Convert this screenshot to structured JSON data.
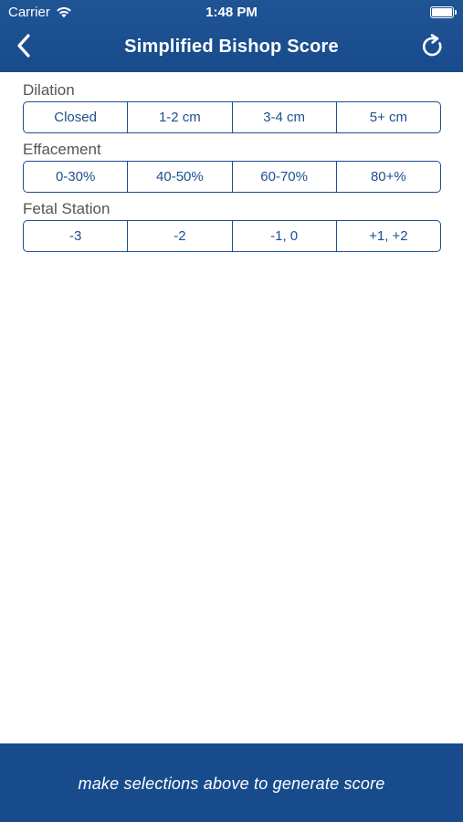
{
  "colors": {
    "brand": "#184b8c",
    "accent": "#1d4f8f",
    "label_text": "#555555",
    "background": "#ffffff"
  },
  "status_bar": {
    "carrier": "Carrier",
    "time": "1:48 PM",
    "icons": [
      "wifi-icon",
      "battery-icon"
    ]
  },
  "nav": {
    "title": "Simplified Bishop Score",
    "back_icon": "chevron-left-icon",
    "reset_icon": "refresh-icon"
  },
  "sections": [
    {
      "label": "Dilation",
      "options": [
        "Closed",
        "1-2 cm",
        "3-4 cm",
        "5+ cm"
      ]
    },
    {
      "label": "Effacement",
      "options": [
        "0-30%",
        "40-50%",
        "60-70%",
        "80+%"
      ]
    },
    {
      "label": "Fetal Station",
      "options": [
        "-3",
        "-2",
        "-1, 0",
        "+1, +2"
      ]
    }
  ],
  "footer": {
    "message": "make selections above to generate score"
  }
}
